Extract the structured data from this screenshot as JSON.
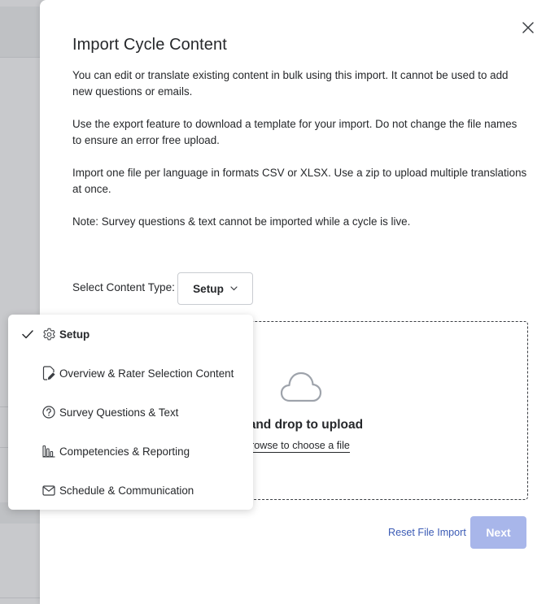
{
  "modal": {
    "title": "Import Cycle Content",
    "paragraphs": [
      "You can edit or translate existing content in bulk using this import. It cannot be used to add new questions or emails.",
      "Use the export feature to download a template for your import. Do not change the file names to ensure an error free upload.",
      "Import one file per language in formats CSV or XLSX. Use a zip to upload multiple translations at once.",
      "Note: Survey questions & text cannot be imported while a cycle is live."
    ],
    "select": {
      "label": "Select Content Type:",
      "value": "Setup"
    },
    "dropzone": {
      "title": "g and drop to upload",
      "subtitle": "rowse to choose a file"
    },
    "footer": {
      "reset_label": "Reset File Import",
      "next_label": "Next"
    }
  },
  "dropdown": {
    "items": [
      {
        "label": "Setup",
        "icon": "gear-icon",
        "selected": true
      },
      {
        "label": "Overview & Rater Selection Content",
        "icon": "document-edit-icon",
        "selected": false
      },
      {
        "label": "Survey Questions & Text",
        "icon": "question-circle-icon",
        "selected": false
      },
      {
        "label": "Competencies & Reporting",
        "icon": "bar-chart-icon",
        "selected": false
      },
      {
        "label": "Schedule & Communication",
        "icon": "envelope-icon",
        "selected": false
      }
    ]
  },
  "colors": {
    "accent": "#3b5bb5",
    "next_button": "#a8b6ea",
    "overlay": "#c8c9cc"
  }
}
